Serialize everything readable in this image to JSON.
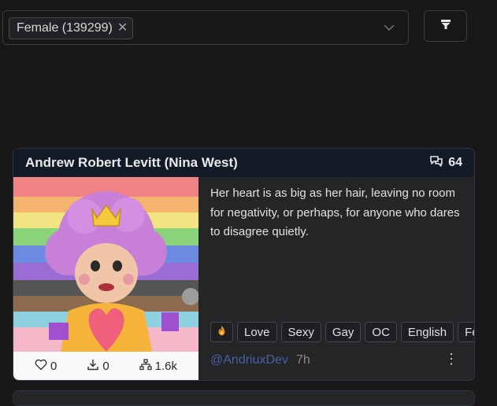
{
  "filter": {
    "chip_label": "Female (139299)",
    "chip_remove": "✕"
  },
  "card": {
    "title": "Andrew Robert Levitt (Nina West)",
    "comment_count": "64",
    "description": "Her heart is as big as her hair, leaving no room for negativity, or perhaps, for anyone who dares to disagree quietly.",
    "stats": {
      "likes": "0",
      "downloads": "0",
      "forks": "1.6k"
    },
    "tags": [
      "Love",
      "Sexy",
      "Gay",
      "OC",
      "English",
      "Fem"
    ],
    "author": "@AndriuxDev",
    "time": "7h",
    "more": "⋮"
  },
  "colors": {
    "background": "#1a1718",
    "card": "#242526",
    "card_header": "#111a26",
    "author": "#4a5fa8"
  },
  "icons": [
    "chevron-down-icon",
    "filter-icon",
    "comments-icon",
    "heart-icon",
    "download-icon",
    "fork-icon",
    "fire-icon",
    "more-icon"
  ]
}
